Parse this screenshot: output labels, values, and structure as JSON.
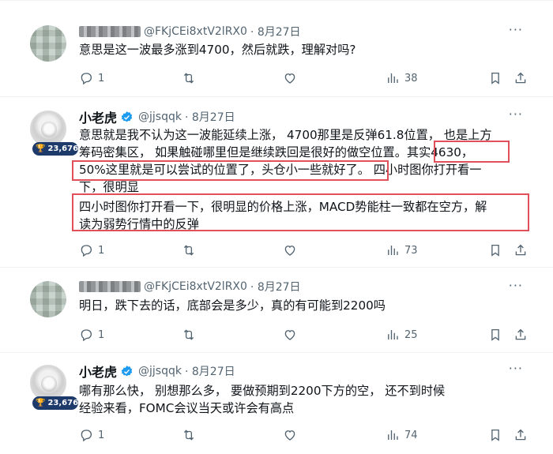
{
  "tweets": [
    {
      "display_name": "",
      "handle": "@FKjCEi8xtV2lRX0",
      "date": "· 8月27日",
      "text": "意思是这一波最多涨到4700，然后就跌，理解对吗?",
      "replies": "1",
      "views": "38"
    },
    {
      "display_name": "小老虎",
      "handle": "@jjsqqk",
      "date": "· 8月27日",
      "badge": "23,676",
      "lines": [
        "意思就是我不认为这一波能延续上涨， 4700那里是反弹61.8位置， 也是上方",
        "筹码密集区， 如果触碰哪里但是继续跌回是很好的做空位置。其实4630，",
        "50%这里就是可以尝试的位置了，头仓小一些就好了。 四小时图你打开看一",
        "下，很明显",
        "四小时图你打开看一下，很明显的价格上涨，MACD势能柱一致都在空方，解",
        "读为弱势行情中的反弹"
      ],
      "replies": "1",
      "views": "73"
    },
    {
      "display_name": "",
      "handle": "@FKjCEi8xtV2lRX0",
      "date": "· 8月27日",
      "text": "明日，跌下去的话，底部会是多少，真的有可能到2200吗",
      "replies": "1",
      "views": "25"
    },
    {
      "display_name": "小老虎",
      "handle": "@jjsqqk",
      "date": "· 8月27日",
      "badge": "23,676",
      "lines": [
        "哪有那么快， 别想那么多， 要做预期到2200下方的空， 还不到时候",
        "经验来看，FOMC会议当天或许会有高点"
      ],
      "replies": "1",
      "views": "74"
    }
  ],
  "icons": {
    "more": "more-icon",
    "reply": "reply-icon",
    "retweet": "retweet-icon",
    "like": "like-icon",
    "views": "views-icon",
    "bookmark": "bookmark-icon",
    "share": "share-icon"
  },
  "colors": {
    "verified": "#1d9bf0",
    "highlight_box": "#e0505a",
    "muted": "#536471",
    "badge_bg": "#1d3a6b"
  }
}
